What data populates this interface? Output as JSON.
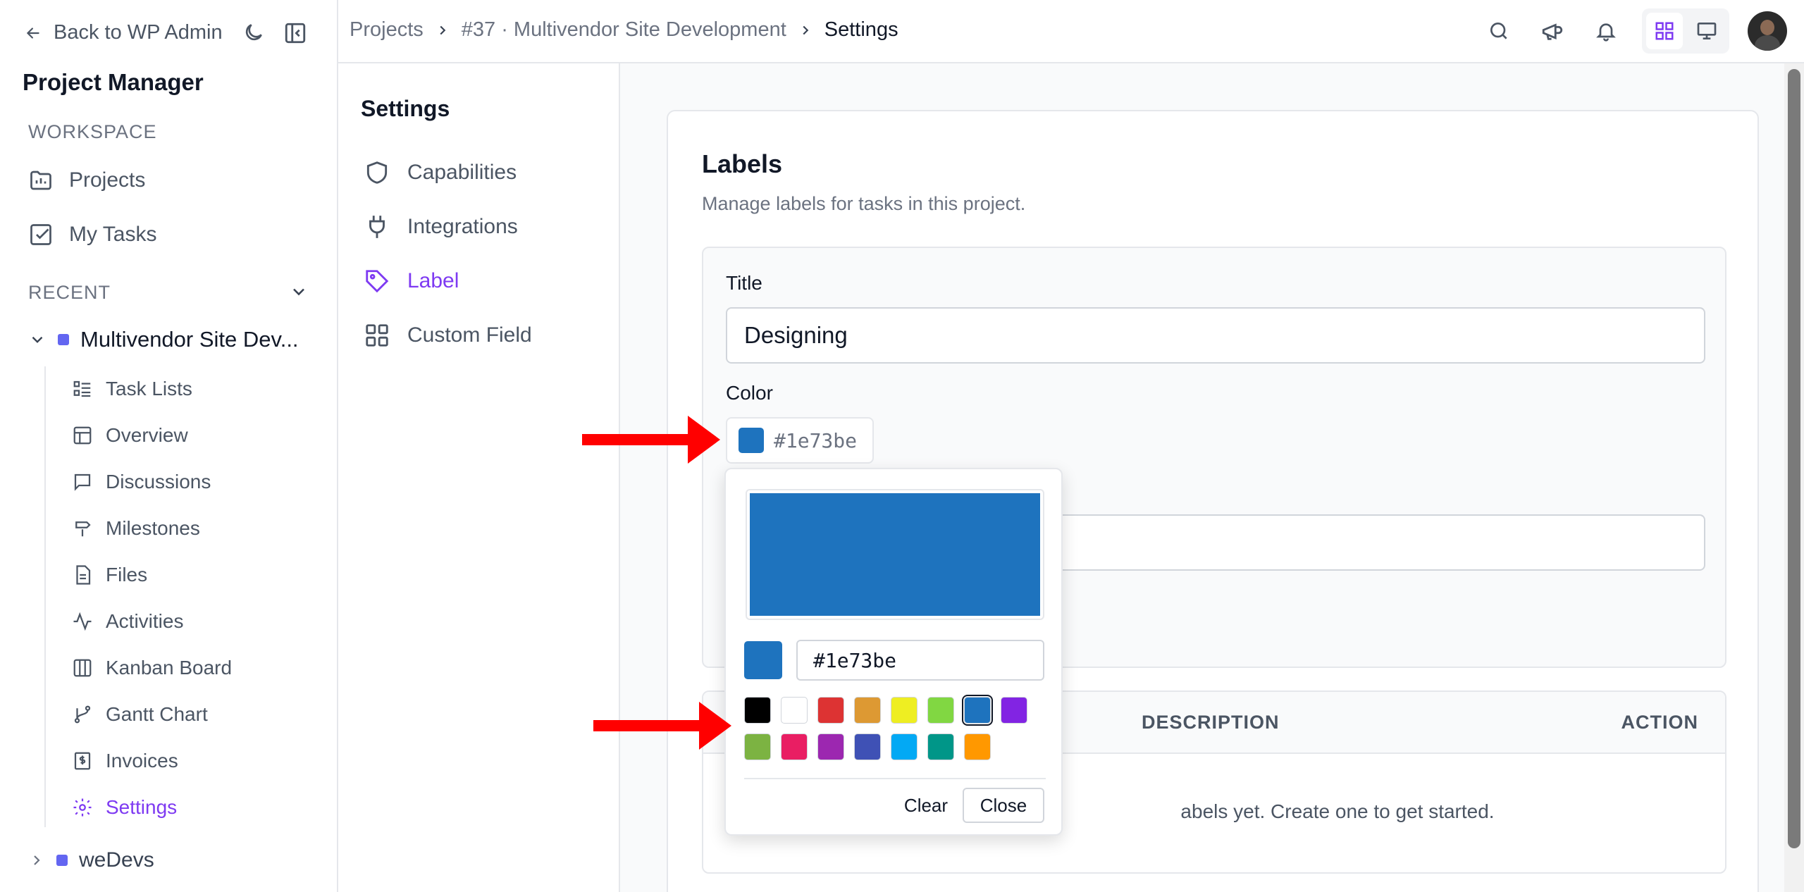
{
  "sidebar": {
    "back_label": "Back to WP Admin",
    "app_title": "Project Manager",
    "workspace_label": "WORKSPACE",
    "workspace_items": [
      {
        "label": "Projects",
        "icon": "folder-icon"
      },
      {
        "label": "My Tasks",
        "icon": "checkbox-icon"
      }
    ],
    "recent_label": "RECENT",
    "project_name": "Multivendor Site Dev...",
    "project_subitems": [
      {
        "label": "Task Lists",
        "icon": "list-icon"
      },
      {
        "label": "Overview",
        "icon": "layout-icon"
      },
      {
        "label": "Discussions",
        "icon": "chat-icon"
      },
      {
        "label": "Milestones",
        "icon": "signpost-icon"
      },
      {
        "label": "Files",
        "icon": "file-icon"
      },
      {
        "label": "Activities",
        "icon": "activity-icon"
      },
      {
        "label": "Kanban Board",
        "icon": "kanban-icon"
      },
      {
        "label": "Gantt Chart",
        "icon": "git-branch-icon"
      },
      {
        "label": "Invoices",
        "icon": "invoice-icon"
      },
      {
        "label": "Settings",
        "icon": "gear-icon"
      }
    ],
    "other_project": "weDevs"
  },
  "breadcrumb": {
    "root": "Projects",
    "project": "#37 · Multivendor Site Development",
    "current": "Settings"
  },
  "settings_nav": {
    "title": "Settings",
    "items": [
      {
        "label": "Capabilities",
        "icon": "shield-icon"
      },
      {
        "label": "Integrations",
        "icon": "plug-icon"
      },
      {
        "label": "Label",
        "icon": "tag-icon"
      },
      {
        "label": "Custom Field",
        "icon": "grid-icon"
      }
    ]
  },
  "labels_card": {
    "title": "Labels",
    "subtitle": "Manage labels for tasks in this project.",
    "title_field_label": "Title",
    "title_value": "Designing",
    "color_field_label": "Color",
    "color_value": "#1e73be",
    "table_headers": {
      "description": "DESCRIPTION",
      "action": "ACTION"
    },
    "empty_message": "abels yet. Create one to get started."
  },
  "color_picker": {
    "hex_value": "#1e73be",
    "selected_color": "#1e73be",
    "presets_row1": [
      "#000000",
      "#ffffff",
      "#dd3333",
      "#dd9933",
      "#eeee22",
      "#81d742",
      "#1e73be",
      "#8224e3"
    ],
    "presets_row2": [
      "#7cb342",
      "#e91e63",
      "#9c27b0",
      "#3f51b5",
      "#03a9f4",
      "#009688",
      "#ff9800"
    ],
    "clear_label": "Clear",
    "close_label": "Close"
  },
  "colors": {
    "accent": "#7e3af2",
    "annotation_arrow": "#ff0000"
  }
}
